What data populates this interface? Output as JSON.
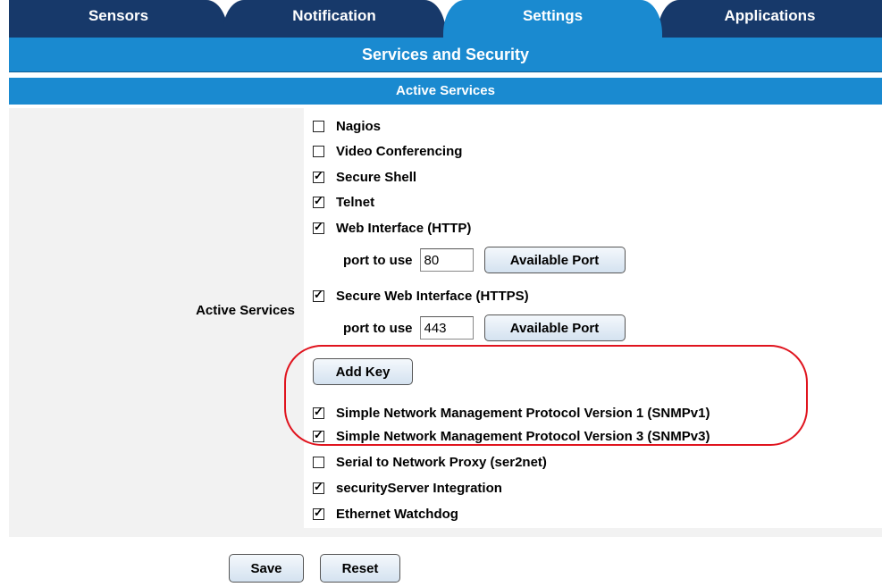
{
  "tabs": [
    {
      "label": "Sensors"
    },
    {
      "label": "Notification"
    },
    {
      "label": "Settings"
    },
    {
      "label": "Applications"
    }
  ],
  "active_tab": "Settings",
  "page_title": "Services and Security",
  "section_title": "Active Services",
  "row_label": "Active Services",
  "services": {
    "nagios": {
      "label": "Nagios",
      "checked": false
    },
    "video": {
      "label": "Video Conferencing",
      "checked": false
    },
    "ssh": {
      "label": "Secure Shell",
      "checked": true
    },
    "telnet": {
      "label": "Telnet",
      "checked": true
    },
    "http": {
      "label": "Web Interface (HTTP)",
      "checked": true
    },
    "https": {
      "label": "Secure Web Interface (HTTPS)",
      "checked": true
    },
    "snmpv1": {
      "label": "Simple Network Management Protocol Version 1 (SNMPv1)",
      "checked": true
    },
    "snmpv3": {
      "label": "Simple Network Management Protocol Version 3 (SNMPv3)",
      "checked": true
    },
    "ser2net": {
      "label": "Serial to Network Proxy (ser2net)",
      "checked": false
    },
    "secserver": {
      "label": "securityServer Integration",
      "checked": true
    },
    "watchdog": {
      "label": "Ethernet Watchdog",
      "checked": true
    }
  },
  "http_port": {
    "label": "port to use",
    "value": "80",
    "button": "Available Port"
  },
  "https_port": {
    "label": "port to use",
    "value": "443",
    "button": "Available Port"
  },
  "add_key_label": "Add Key",
  "actions": {
    "save": "Save",
    "reset": "Reset"
  },
  "colors": {
    "tab_dark": "#17396a",
    "tab_active": "#1a8ad0",
    "header": "#1a8ad0",
    "highlight": "#e0141e"
  }
}
